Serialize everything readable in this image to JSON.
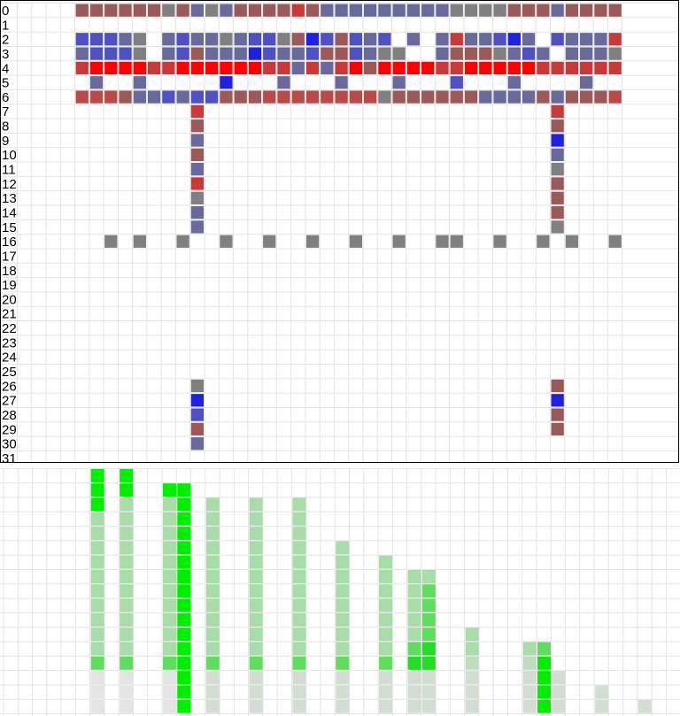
{
  "colors": {
    "red": "#ff0000",
    "dark_red": "#c83a3a",
    "brick": "#b84a4a",
    "mauve": "#9a5a5a",
    "gray": "#808080",
    "slate": "#6a6a9a",
    "blue_mid": "#5050c0",
    "blue": "#2020e0",
    "green": "#00ee00",
    "green_bright": "#22dd22",
    "green_light": "#60dd60",
    "green_pale": "#a8dca8",
    "green_faint": "#c0dcc0",
    "gray_faint": "#d4ddd4",
    "gray_light": "#e4e4e4",
    "grid": "#e4e4e4",
    "border": "#000000"
  },
  "chart_data": [
    {
      "type": "heatmap",
      "title": "",
      "row_labels": [
        "0",
        "1",
        "2",
        "3",
        "4",
        "5",
        "6",
        "7",
        "8",
        "9",
        "10",
        "11",
        "12",
        "13",
        "14",
        "15",
        "16",
        "17",
        "18",
        "19",
        "20",
        "21",
        "22",
        "23",
        "24",
        "25",
        "26",
        "27",
        "28",
        "29",
        "30",
        "31"
      ],
      "n_cols": 42,
      "legend": "#=gray,S=slate,M=mauve,B=blue_mid,b=blue,R=red,D=dark_red,K=brick,.=empty",
      "rows": [
        "....MMMMMM#MS#SMMMMDMSSSSSSSSS####MMMSMMMM",
        "..........................................",
        "....BBBS#.SBSS#SBB#MbBMBSB.S.SDSSBbS.BSSSDS",
        "....SBBB#.SBMSSSbBSSBMMBS##..SMMM#SBS.SSS#",
        "....DRRRRDDRRRRRRDDSDSDRMRRRRDDRRRRRDDDDDD",
        ".....S..S.....b...S...S...S...B...S....S..",
        "....KKKMSSBSBBMMMKKKKKKKK#MMMMMMSSSSMSMMMK",
        "............D........................D....",
        "............M........................M....",
        "............S........................b....",
        "............M........................S....",
        "............S........................#....",
        "............D........................M....",
        "............#........................M....",
        "............S........................M....",
        "............S........................#....",
        "......#.#..#..#..#..#..#..#..##..#..#.#..#..#",
        "..........................................",
        "..........................................",
        "..........................................",
        "..........................................",
        "..........................................",
        "..........................................",
        "..........................................",
        "..........................................",
        "..........................................",
        "............#........................M....",
        "............b........................b....",
        "............B........................M....",
        "............M........................M....",
        "............S.............................",
        ".........................................."
      ]
    },
    {
      "type": "bar",
      "title": "",
      "xlabel": "",
      "ylabel": "",
      "n_cols": 47,
      "n_rows": 17,
      "legend": "G=green,g=green_bright,l=green_light,p=green_pale,f=green_faint,a=gray_faint,e=gray_light",
      "columns": [
        {
          "col": 6,
          "cells": "eeelppppppppppGGG"
        },
        {
          "col": 8,
          "cells": "eeelpppppppppppGG"
        },
        {
          "col": 11,
          "cells": "eeelpppppppppppG"
        },
        {
          "col": 12,
          "cells": "GGGGGGGGGGGGGGGG"
        },
        {
          "col": 14,
          "cells": "aaalppppppppppp"
        },
        {
          "col": 17,
          "cells": "aaalppppppppppp"
        },
        {
          "col": 20,
          "cells": "aaalppppppppppp"
        },
        {
          "col": 23,
          "cells": "aaalpppppppp"
        },
        {
          "col": 26,
          "cells": "aaalppppppp"
        },
        {
          "col": 28,
          "cells": "aaaglppppp"
        },
        {
          "col": 29,
          "cells": "aaaggllllp"
        },
        {
          "col": 32,
          "cells": "aaafpp"
        },
        {
          "col": 36,
          "cells": "aaafp"
        },
        {
          "col": 37,
          "cells": "GGGGl"
        },
        {
          "col": 38,
          "cells": "aaa"
        },
        {
          "col": 41,
          "cells": "aa"
        },
        {
          "col": 44,
          "cells": "a"
        }
      ]
    }
  ]
}
